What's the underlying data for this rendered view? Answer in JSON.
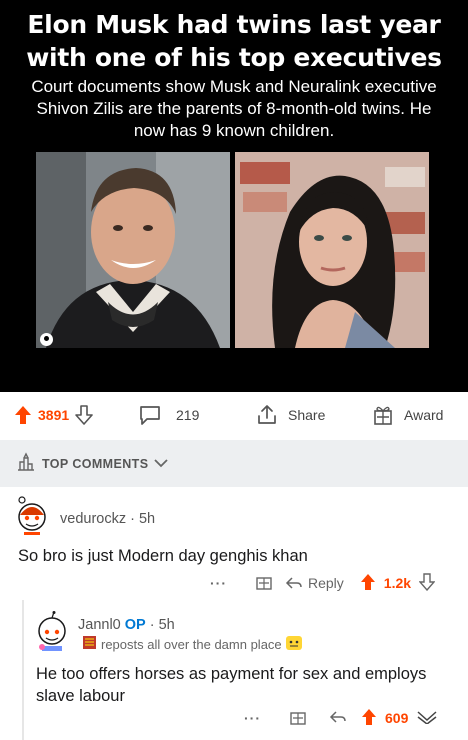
{
  "post": {
    "headline": "Elon Musk had twins last year with one of his top executives",
    "subhead": "Court documents show Musk and Neuralink executive Shivon Zilis are the parents of 8-month-old twins. He now has 9 known children."
  },
  "action_bar": {
    "upvotes": "3891",
    "comments": "219",
    "share_label": "Share",
    "award_label": "Award"
  },
  "sort": {
    "label": "TOP COMMENTS"
  },
  "comments": [
    {
      "username": "vedurockz",
      "time": "5h",
      "body": "So bro is just Modern  day genghis khan",
      "reply_label": "Reply",
      "score": "1.2k",
      "more": "···"
    },
    {
      "username": "Jannl0",
      "op_label": "OP",
      "time": "5h",
      "flair": "reposts all over the damn place",
      "body": "He too offers horses as payment for sex and employs slave labour",
      "score": "609",
      "more": "···"
    }
  ],
  "colors": {
    "accent": "#ff4500",
    "op": "#0079d3",
    "sort_bg": "#edeff1"
  },
  "icons": [
    "upvote-icon",
    "downvote-icon",
    "comment-icon",
    "share-icon",
    "award-icon",
    "top-comments-icon",
    "chevron-down-icon",
    "reply-icon",
    "collapse-icon"
  ]
}
